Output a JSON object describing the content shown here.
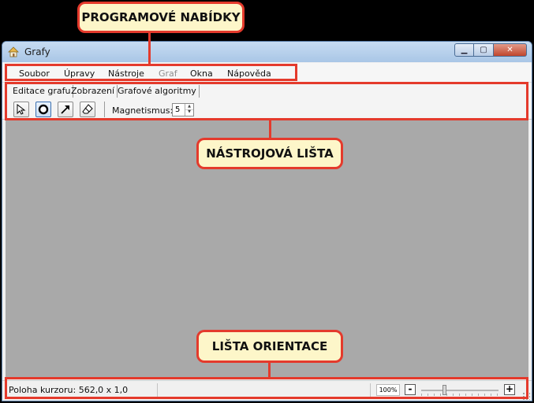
{
  "window": {
    "title": "Grafy"
  },
  "window_controls": {
    "minimize": "▁",
    "maximize": "▢",
    "close": "✕"
  },
  "menu": {
    "items": [
      {
        "label": "Soubor",
        "enabled": true
      },
      {
        "label": "Úpravy",
        "enabled": true
      },
      {
        "label": "Nástroje",
        "enabled": true
      },
      {
        "label": "Graf",
        "enabled": false
      },
      {
        "label": "Okna",
        "enabled": true
      },
      {
        "label": "Nápověda",
        "enabled": true
      }
    ]
  },
  "toolbar": {
    "tabs": [
      "Editace grafu",
      "Zobrazení",
      "Grafové algoritmy"
    ],
    "tools": [
      {
        "name": "select-tool",
        "icon": "arrow-cursor-icon"
      },
      {
        "name": "vertex-tool",
        "icon": "circle-icon"
      },
      {
        "name": "edge-tool",
        "icon": "diagonal-arrow-icon"
      },
      {
        "name": "eraser-tool",
        "icon": "eraser-icon"
      }
    ],
    "magnetism_label": "Magnetismus:",
    "magnetism_value": "5"
  },
  "statusbar": {
    "cursor_position": "Poloha kurzoru: 562,0 x 1,0",
    "zoom": "100%",
    "zoom_out": "-",
    "zoom_in": "+",
    "zoom_level": 0.3
  },
  "annotations": {
    "menus": "PROGRAMOVÉ NABÍDKY",
    "toolbar": "NÁSTROJOVÁ LIŠTA",
    "orientation": "LIŠTA ORIENTACE"
  },
  "colors": {
    "highlight": "#e43a2c",
    "callout_bg": "#fdf6c9",
    "canvas": "#a9a9a9"
  }
}
